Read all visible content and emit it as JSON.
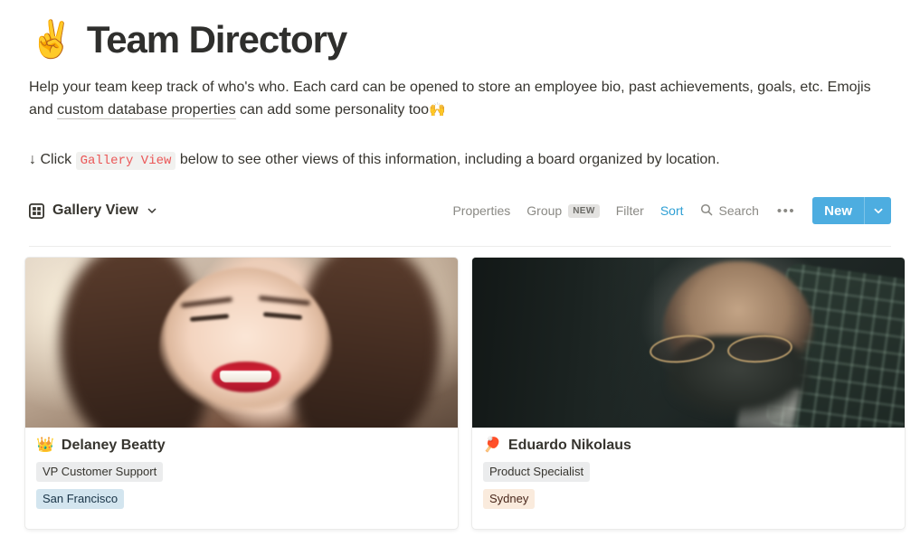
{
  "page": {
    "title_emoji": "✌️",
    "title": "Team Directory",
    "description_part1": "Help your team keep track of who's who. Each card can be opened to store an employee bio, past achievements, goals, etc. Emojis and ",
    "description_link": "custom database properties",
    "description_part2": " can add some personality too",
    "description_end_emoji": "🙌",
    "callout_arrow": "↓",
    "callout_before": "Click",
    "callout_code": "Gallery View",
    "callout_after": "below to see other views of this information, including a board organized by location."
  },
  "toolbar": {
    "view_icon": "gallery-grid-icon",
    "view_name": "Gallery View",
    "view_chevron": "chevron-down-icon",
    "properties_label": "Properties",
    "group_label": "Group",
    "group_badge": "NEW",
    "filter_label": "Filter",
    "sort_label": "Sort",
    "search_icon": "search-icon",
    "search_label": "Search",
    "more_label": "•••",
    "new_label": "New",
    "new_caret": "chevron-down-icon",
    "accent_color": "#2e9fd4",
    "new_button_color": "#4dade0"
  },
  "cards": [
    {
      "emoji": "👑",
      "name": "Delaney Beatty",
      "role": "VP Customer Support",
      "location": "San Francisco",
      "location_color": "#d3e5ef",
      "photo_alt": "smiling-woman-portrait"
    },
    {
      "emoji": "🏓",
      "name": "Eduardo Nikolaus",
      "role": "Product Specialist",
      "location": "Sydney",
      "location_color": "#faebdd",
      "photo_alt": "bearded-man-with-glasses-portrait"
    }
  ]
}
